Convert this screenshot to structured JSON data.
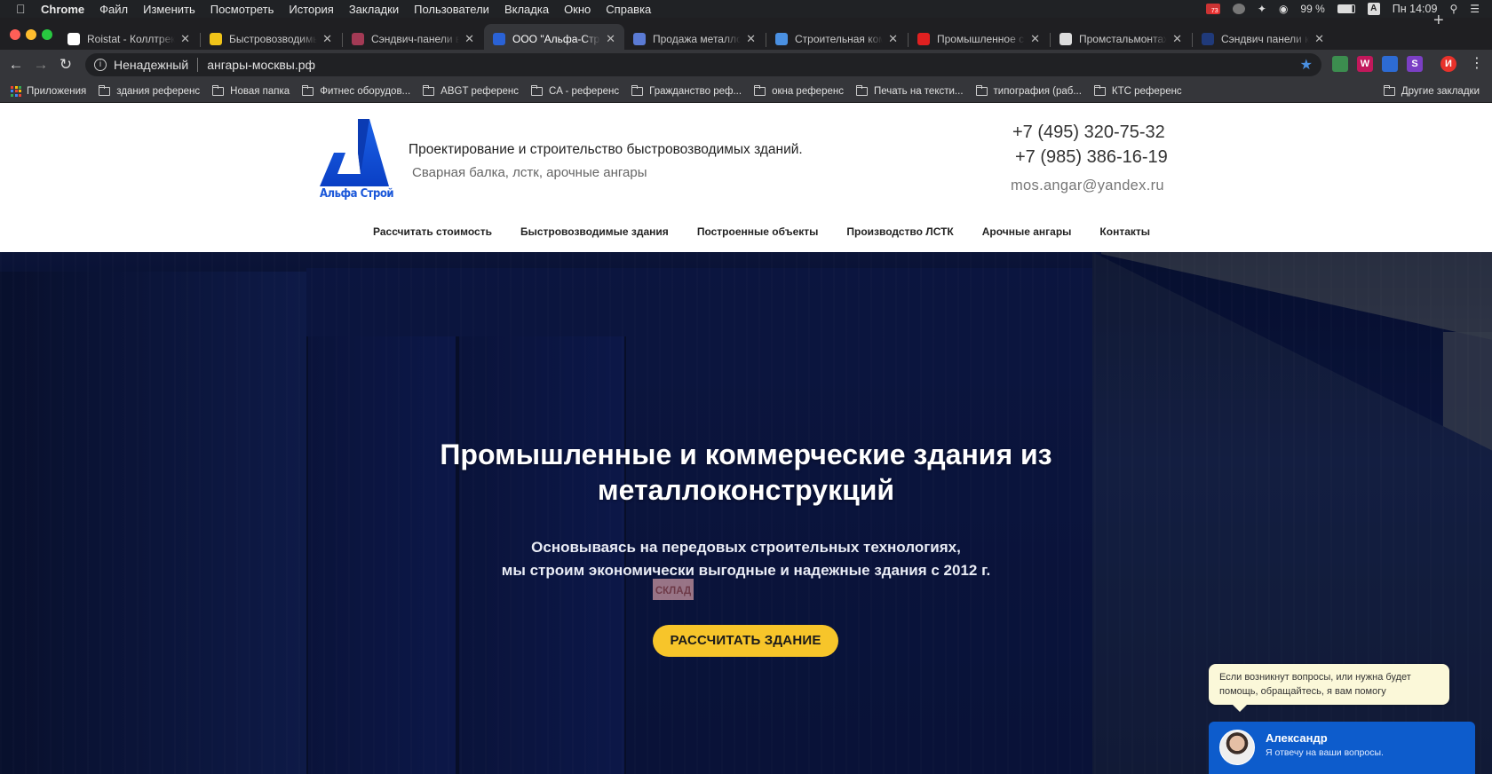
{
  "menubar": {
    "app": "Chrome",
    "items": [
      "Файл",
      "Изменить",
      "Посмотреть",
      "История",
      "Закладки",
      "Пользователи",
      "Вкладка",
      "Окно",
      "Справка"
    ],
    "battery": "99 %",
    "clock": "Пн 14:09",
    "mail_badge": "73",
    "input_lang": "A"
  },
  "tabs": [
    {
      "title": "Roistat - Коллтрекинг",
      "favicon": "roistat-icon",
      "color": "#ffffff"
    },
    {
      "title": "Быстровозводимые здания",
      "favicon": "building-icon",
      "color": "#f0c419"
    },
    {
      "title": "Сэндвич-панели в Санкт",
      "favicon": "panel-icon",
      "color": "#a33a55"
    },
    {
      "title": "ООО \"Альфа-Строй\". Быстровозводимые",
      "favicon": "alfa-icon",
      "color": "#2a62d6",
      "active": true
    },
    {
      "title": "Продажа металлопроката",
      "favicon": "diamond-icon",
      "color": "#5b7bd5"
    },
    {
      "title": "Строительная компания",
      "favicon": "globe-icon",
      "color": "#4a90e2"
    },
    {
      "title": "Промышленное строительство",
      "favicon": "arrow-icon",
      "color": "#e02020"
    },
    {
      "title": "Промстальмонтаж - Производство",
      "favicon": "world-icon",
      "color": "#dddddd"
    },
    {
      "title": "Сэндвич панели купить",
      "favicon": "sandwich-icon",
      "color": "#203a7a"
    }
  ],
  "toolbar": {
    "security_label": "Ненадежный",
    "url": "ангары-москвы.рф",
    "profile_initial": "И",
    "extensions": [
      {
        "name": "ext-grid-icon",
        "label": "",
        "color": "#3c8d4f"
      },
      {
        "name": "ext-w-icon",
        "label": "W",
        "color": "#c2185b"
      },
      {
        "name": "ext-translate-icon",
        "label": "",
        "color": "#2d6bd3"
      },
      {
        "name": "ext-s-icon",
        "label": "S",
        "color": "#7b3fc4"
      }
    ]
  },
  "bookmarks": {
    "apps_label": "Приложения",
    "items": [
      "здания референс",
      "Новая папка",
      "Фитнес оборудов...",
      "ABGT референс",
      "CA - референс",
      "Гражданство реф...",
      "окна референс",
      "Печать на тексти...",
      "типография (раб...",
      "КТС референс"
    ],
    "other": "Другие закладки"
  },
  "site": {
    "logo_text": "Альфа Строй",
    "tagline": "Проектирование и строительство быстровозводимых зданий.",
    "subtagline": "Сварная балка, лстк, арочные ангары",
    "phone1": "+7 (495) 320-75-32",
    "phone2": "+7 (985) 386-16-19",
    "email": "mos.angar@yandex.ru",
    "nav": [
      "Рассчитать стоимость",
      "Быстровозводимые здания",
      "Построенные объекты",
      "Производство ЛСТК",
      "Арочные ангары",
      "Контакты"
    ],
    "brand_color": "#1a57d9"
  },
  "hero": {
    "title_line1": "Промышленные и коммерческие здания из",
    "title_line2": "металлоконструкций",
    "sub_line1": "Основываясь на передовых строительных технологиях,",
    "sub_line2": "мы строим экономически выгодные и надежные здания с 2012 г.",
    "sign_text": "СКЛАД",
    "cta": "РАССЧИТАТЬ ЗДАНИЕ",
    "cta_color": "#f7c52a"
  },
  "chat": {
    "bubble": "Если возникнут вопросы, или нужна будет помощь, обращайтесь, я вам помогу",
    "name": "Александр",
    "subtitle": "Я отвечу на ваши вопросы."
  }
}
